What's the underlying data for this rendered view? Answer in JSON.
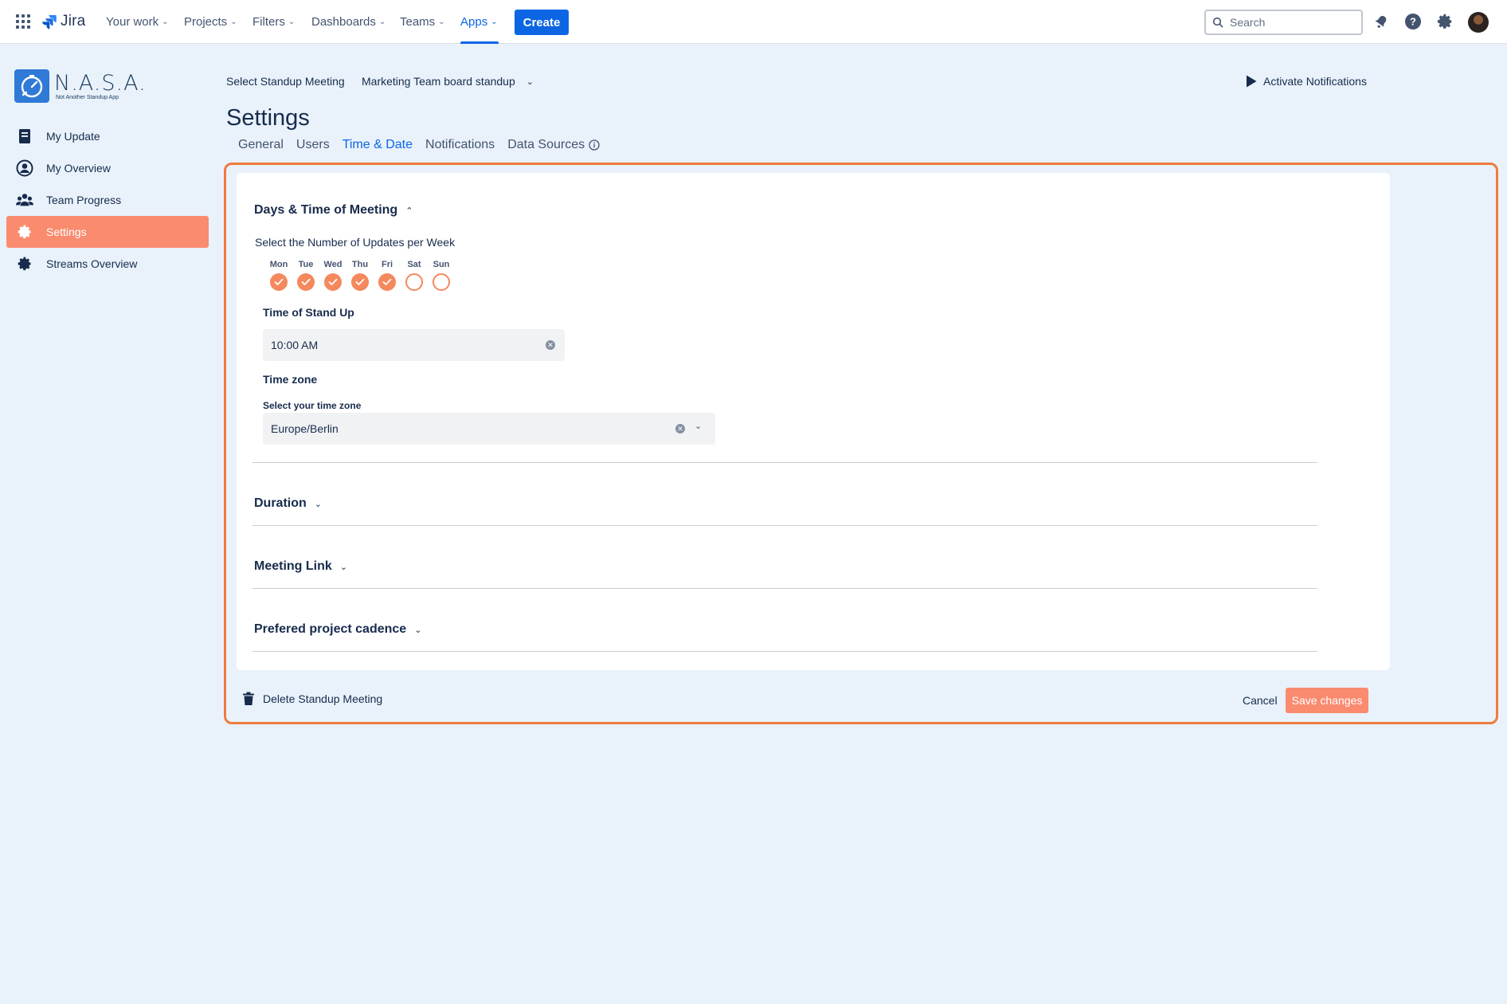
{
  "topnav": {
    "product": "Jira",
    "items": [
      {
        "label": "Your work"
      },
      {
        "label": "Projects"
      },
      {
        "label": "Filters"
      },
      {
        "label": "Dashboards"
      },
      {
        "label": "Teams"
      },
      {
        "label": "Apps"
      }
    ],
    "create_label": "Create",
    "search_placeholder": "Search"
  },
  "app": {
    "logo_title": "N.A.S.A.",
    "logo_subtitle": "Not Another Standup App"
  },
  "sidebar": {
    "items": [
      {
        "label": "My Update",
        "icon": "document-icon"
      },
      {
        "label": "My Overview",
        "icon": "user-circle-icon"
      },
      {
        "label": "Team Progress",
        "icon": "team-icon"
      },
      {
        "label": "Settings",
        "icon": "gear-icon"
      },
      {
        "label": "Streams Overview",
        "icon": "gear-icon"
      }
    ],
    "active_index": 3
  },
  "header": {
    "standup_label": "Select Standup Meeting",
    "standup_value": "Marketing Team board standup",
    "activate_label": "Activate Notifications",
    "page_title": "Settings",
    "tabs": [
      {
        "label": "General"
      },
      {
        "label": "Users"
      },
      {
        "label": "Time & Date"
      },
      {
        "label": "Notifications"
      },
      {
        "label": "Data Sources"
      }
    ],
    "active_tab": "Time & Date"
  },
  "panel": {
    "days_section": {
      "title": "Days & Time of Meeting",
      "updates_label": "Select the Number of Updates per Week",
      "days": [
        {
          "name": "Mon",
          "checked": true
        },
        {
          "name": "Tue",
          "checked": true
        },
        {
          "name": "Wed",
          "checked": true
        },
        {
          "name": "Thu",
          "checked": true
        },
        {
          "name": "Fri",
          "checked": true
        },
        {
          "name": "Sat",
          "checked": false
        },
        {
          "name": "Sun",
          "checked": false
        }
      ],
      "time_label": "Time of Stand Up",
      "time_value": "10:00 AM",
      "timezone_label": "Time zone",
      "timezone_select_label": "Select your time zone",
      "timezone_value": "Europe/Berlin"
    },
    "collapsed_sections": [
      {
        "title": "Duration"
      },
      {
        "title": "Meeting Link"
      },
      {
        "title": "Prefered project cadence"
      }
    ],
    "delete_label": "Delete Standup Meeting",
    "cancel_label": "Cancel",
    "save_label": "Save changes"
  },
  "colors": {
    "accent": "#fa8b6f",
    "frame": "#f07a3e",
    "primary": "#0c66e4",
    "background": "#e9f2fb"
  }
}
